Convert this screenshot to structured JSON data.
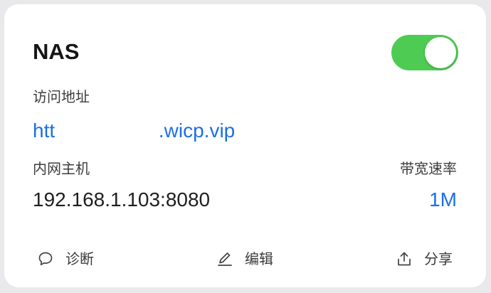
{
  "card": {
    "title": "NAS",
    "enabled": true,
    "access_address_label": "访问地址",
    "access_address": "htt                          .wicp.vip",
    "lan_host_label": "内网主机",
    "lan_host": "192.168.1.103:8080",
    "bandwidth_label": "带宽速率",
    "bandwidth": "1M"
  },
  "actions": {
    "diagnose": {
      "label": "诊断",
      "icon": "chat-bubble-icon"
    },
    "edit": {
      "label": "编辑",
      "icon": "pencil-icon"
    },
    "share": {
      "label": "分享",
      "icon": "share-upload-icon"
    }
  },
  "colors": {
    "accent": "#1c6fe8",
    "toggle_on": "#4ecb53",
    "background": "#e9e9ec"
  }
}
